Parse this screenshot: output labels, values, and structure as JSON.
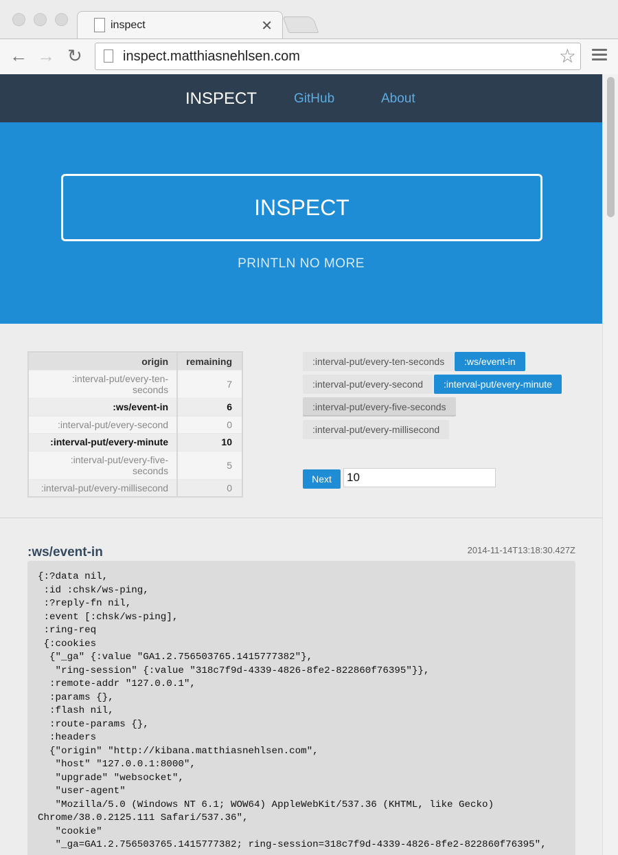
{
  "browser": {
    "tab_title": "inspect",
    "url": "inspect.matthiasnehlsen.com"
  },
  "nav": {
    "brand": "INSPECT",
    "links": [
      "GitHub",
      "About"
    ]
  },
  "hero": {
    "title": "INSPECT",
    "subtitle": "PRINTLN NO MORE"
  },
  "origins_table": {
    "headers": [
      "origin",
      "remaining"
    ],
    "rows": [
      {
        "origin": ":interval-put/every-ten-seconds",
        "remaining": "7",
        "active": false
      },
      {
        "origin": ":ws/event-in",
        "remaining": "6",
        "active": true
      },
      {
        "origin": ":interval-put/every-second",
        "remaining": "0",
        "active": false
      },
      {
        "origin": ":interval-put/every-minute",
        "remaining": "10",
        "active": true
      },
      {
        "origin": ":interval-put/every-five-seconds",
        "remaining": "5",
        "active": false
      },
      {
        "origin": ":interval-put/every-millisecond",
        "remaining": "0",
        "active": false
      }
    ]
  },
  "filters": [
    {
      "label": ":interval-put/every-ten-seconds",
      "active": false
    },
    {
      "label": ":ws/event-in",
      "active": true
    },
    {
      "label": ":interval-put/every-second",
      "active": false
    },
    {
      "label": ":interval-put/every-minute",
      "active": true
    },
    {
      "label": ":interval-put/every-five-seconds",
      "active": false
    },
    {
      "label": ":interval-put/every-millisecond",
      "active": false
    }
  ],
  "next": {
    "button_label": "Next",
    "count_value": "10"
  },
  "event": {
    "name": ":ws/event-in",
    "timestamp": "2014-11-14T13:18:30.427Z",
    "body": "{:?data nil,\n :id :chsk/ws-ping,\n :?reply-fn nil,\n :event [:chsk/ws-ping],\n :ring-req\n {:cookies\n  {\"_ga\" {:value \"GA1.2.756503765.1415777382\"},\n   \"ring-session\" {:value \"318c7f9d-4339-4826-8fe2-822860f76395\"}},\n  :remote-addr \"127.0.0.1\",\n  :params {},\n  :flash nil,\n  :route-params {},\n  :headers\n  {\"origin\" \"http://kibana.matthiasnehlsen.com\",\n   \"host\" \"127.0.0.1:8000\",\n   \"upgrade\" \"websocket\",\n   \"user-agent\"\n   \"Mozilla/5.0 (Windows NT 6.1; WOW64) AppleWebKit/537.36 (KHTML, like Gecko)\nChrome/38.0.2125.111 Safari/537.36\",\n   \"cookie\"\n   \"_ga=GA1.2.756503765.1415777382; ring-session=318c7f9d-4339-4826-8fe2-822860f76395\","
  }
}
